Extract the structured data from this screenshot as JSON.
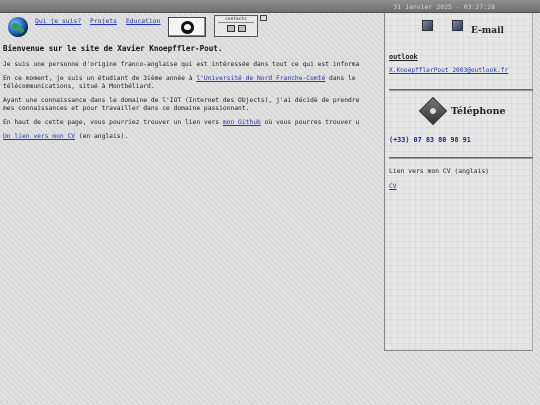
{
  "topbar": {
    "datetime": "31 Janvier 2025 - 03:27:28"
  },
  "nav": {
    "items": [
      "Qui je suis?",
      "Projets",
      "Education"
    ]
  },
  "contacts_button": {
    "label": "contacts"
  },
  "main": {
    "title": "Bienvenue sur le site de Xavier Knoepffler-Pout.",
    "p1": "Je suis une personne d'origine franco-anglaise qui est intéressée dans tout ce qui est informa",
    "p2_before": "En ce moment, je suis un étudiant de 3ième année à ",
    "p2_link": "l'Université de Nord Franche-Comté",
    "p2_after_line1": " dans le",
    "p2_line2": "télécommunications, situé à Montbéliard.",
    "p3_line1": "Ayant une connaissance dans le domaine de l'IOT (Internet des Objects), j'ai décidé de prendre",
    "p3_line2": "mes connaissances et pour travailler dans ce domaine passionnant.",
    "p4_before": "En haut de cette page, vous pourriez trouver un lien vers ",
    "p4_link": "mon Github",
    "p4_after": " où vous pourres trouver u",
    "p5_link": "Un lien vers mon CV",
    "p5_after": " (en anglais)."
  },
  "sidebar": {
    "email_title": "E-mail",
    "email_label": "outlook",
    "email_value": "X.KnoepfflerPout_2003@outlook.fr",
    "phone_title": "Téléphone",
    "phone_value": "(+33) 07 83 80 98 91",
    "cv_text": "Lien vers mon CV (anglais)",
    "cv_link": "CV"
  },
  "colors": {
    "link": "#2233bb",
    "topbar": "#7f7f7f",
    "background": "#dcdcdc"
  }
}
